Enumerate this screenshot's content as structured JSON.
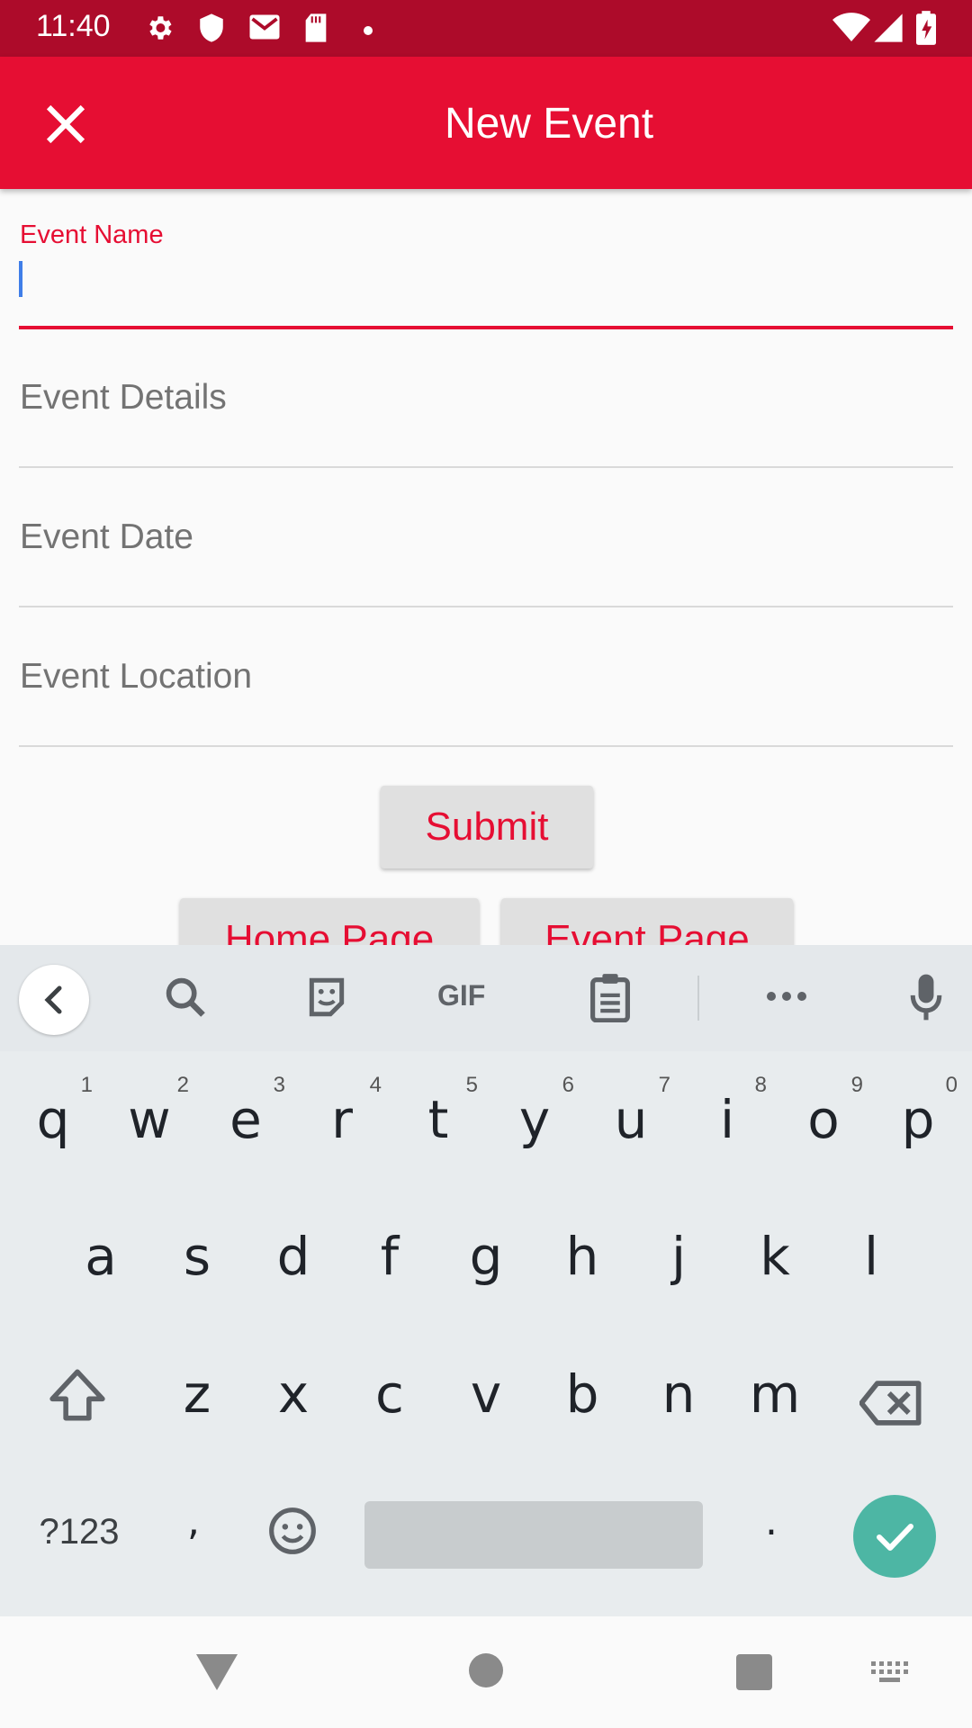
{
  "status_bar": {
    "time": "11:40",
    "icons": [
      "gear-icon",
      "shield-icon",
      "gmail-icon",
      "sd-card-icon",
      "dot-icon",
      "wifi-icon",
      "signal-icon",
      "battery-icon"
    ]
  },
  "app_bar": {
    "title": "New Event",
    "close_icon": "close-icon"
  },
  "form": {
    "fields": [
      {
        "label": "Event Name",
        "value": ""
      },
      {
        "label": "Event Details",
        "value": ""
      },
      {
        "label": "Event Date",
        "value": ""
      },
      {
        "label": "Event Location",
        "value": ""
      }
    ],
    "submit_label": "Submit",
    "home_label": "Home Page",
    "event_label": "Event Page"
  },
  "keyboard": {
    "toolbar": [
      "back-icon",
      "search-icon",
      "sticker-icon",
      "GIF",
      "clipboard-icon",
      "more-icon",
      "mic-icon"
    ],
    "gif_label": "GIF",
    "row1": [
      "q",
      "w",
      "e",
      "r",
      "t",
      "y",
      "u",
      "i",
      "o",
      "p"
    ],
    "row1_hints": [
      "1",
      "2",
      "3",
      "4",
      "5",
      "6",
      "7",
      "8",
      "9",
      "0"
    ],
    "row2": [
      "a",
      "s",
      "d",
      "f",
      "g",
      "h",
      "j",
      "k",
      "l"
    ],
    "row3": [
      "z",
      "x",
      "c",
      "v",
      "b",
      "n",
      "m"
    ],
    "symbols_label": "?123",
    "comma": ",",
    "period": "."
  },
  "colors": {
    "primary": "#e60e33",
    "status_bar": "#ad0b2a",
    "accent_teal": "#4db6a4"
  }
}
